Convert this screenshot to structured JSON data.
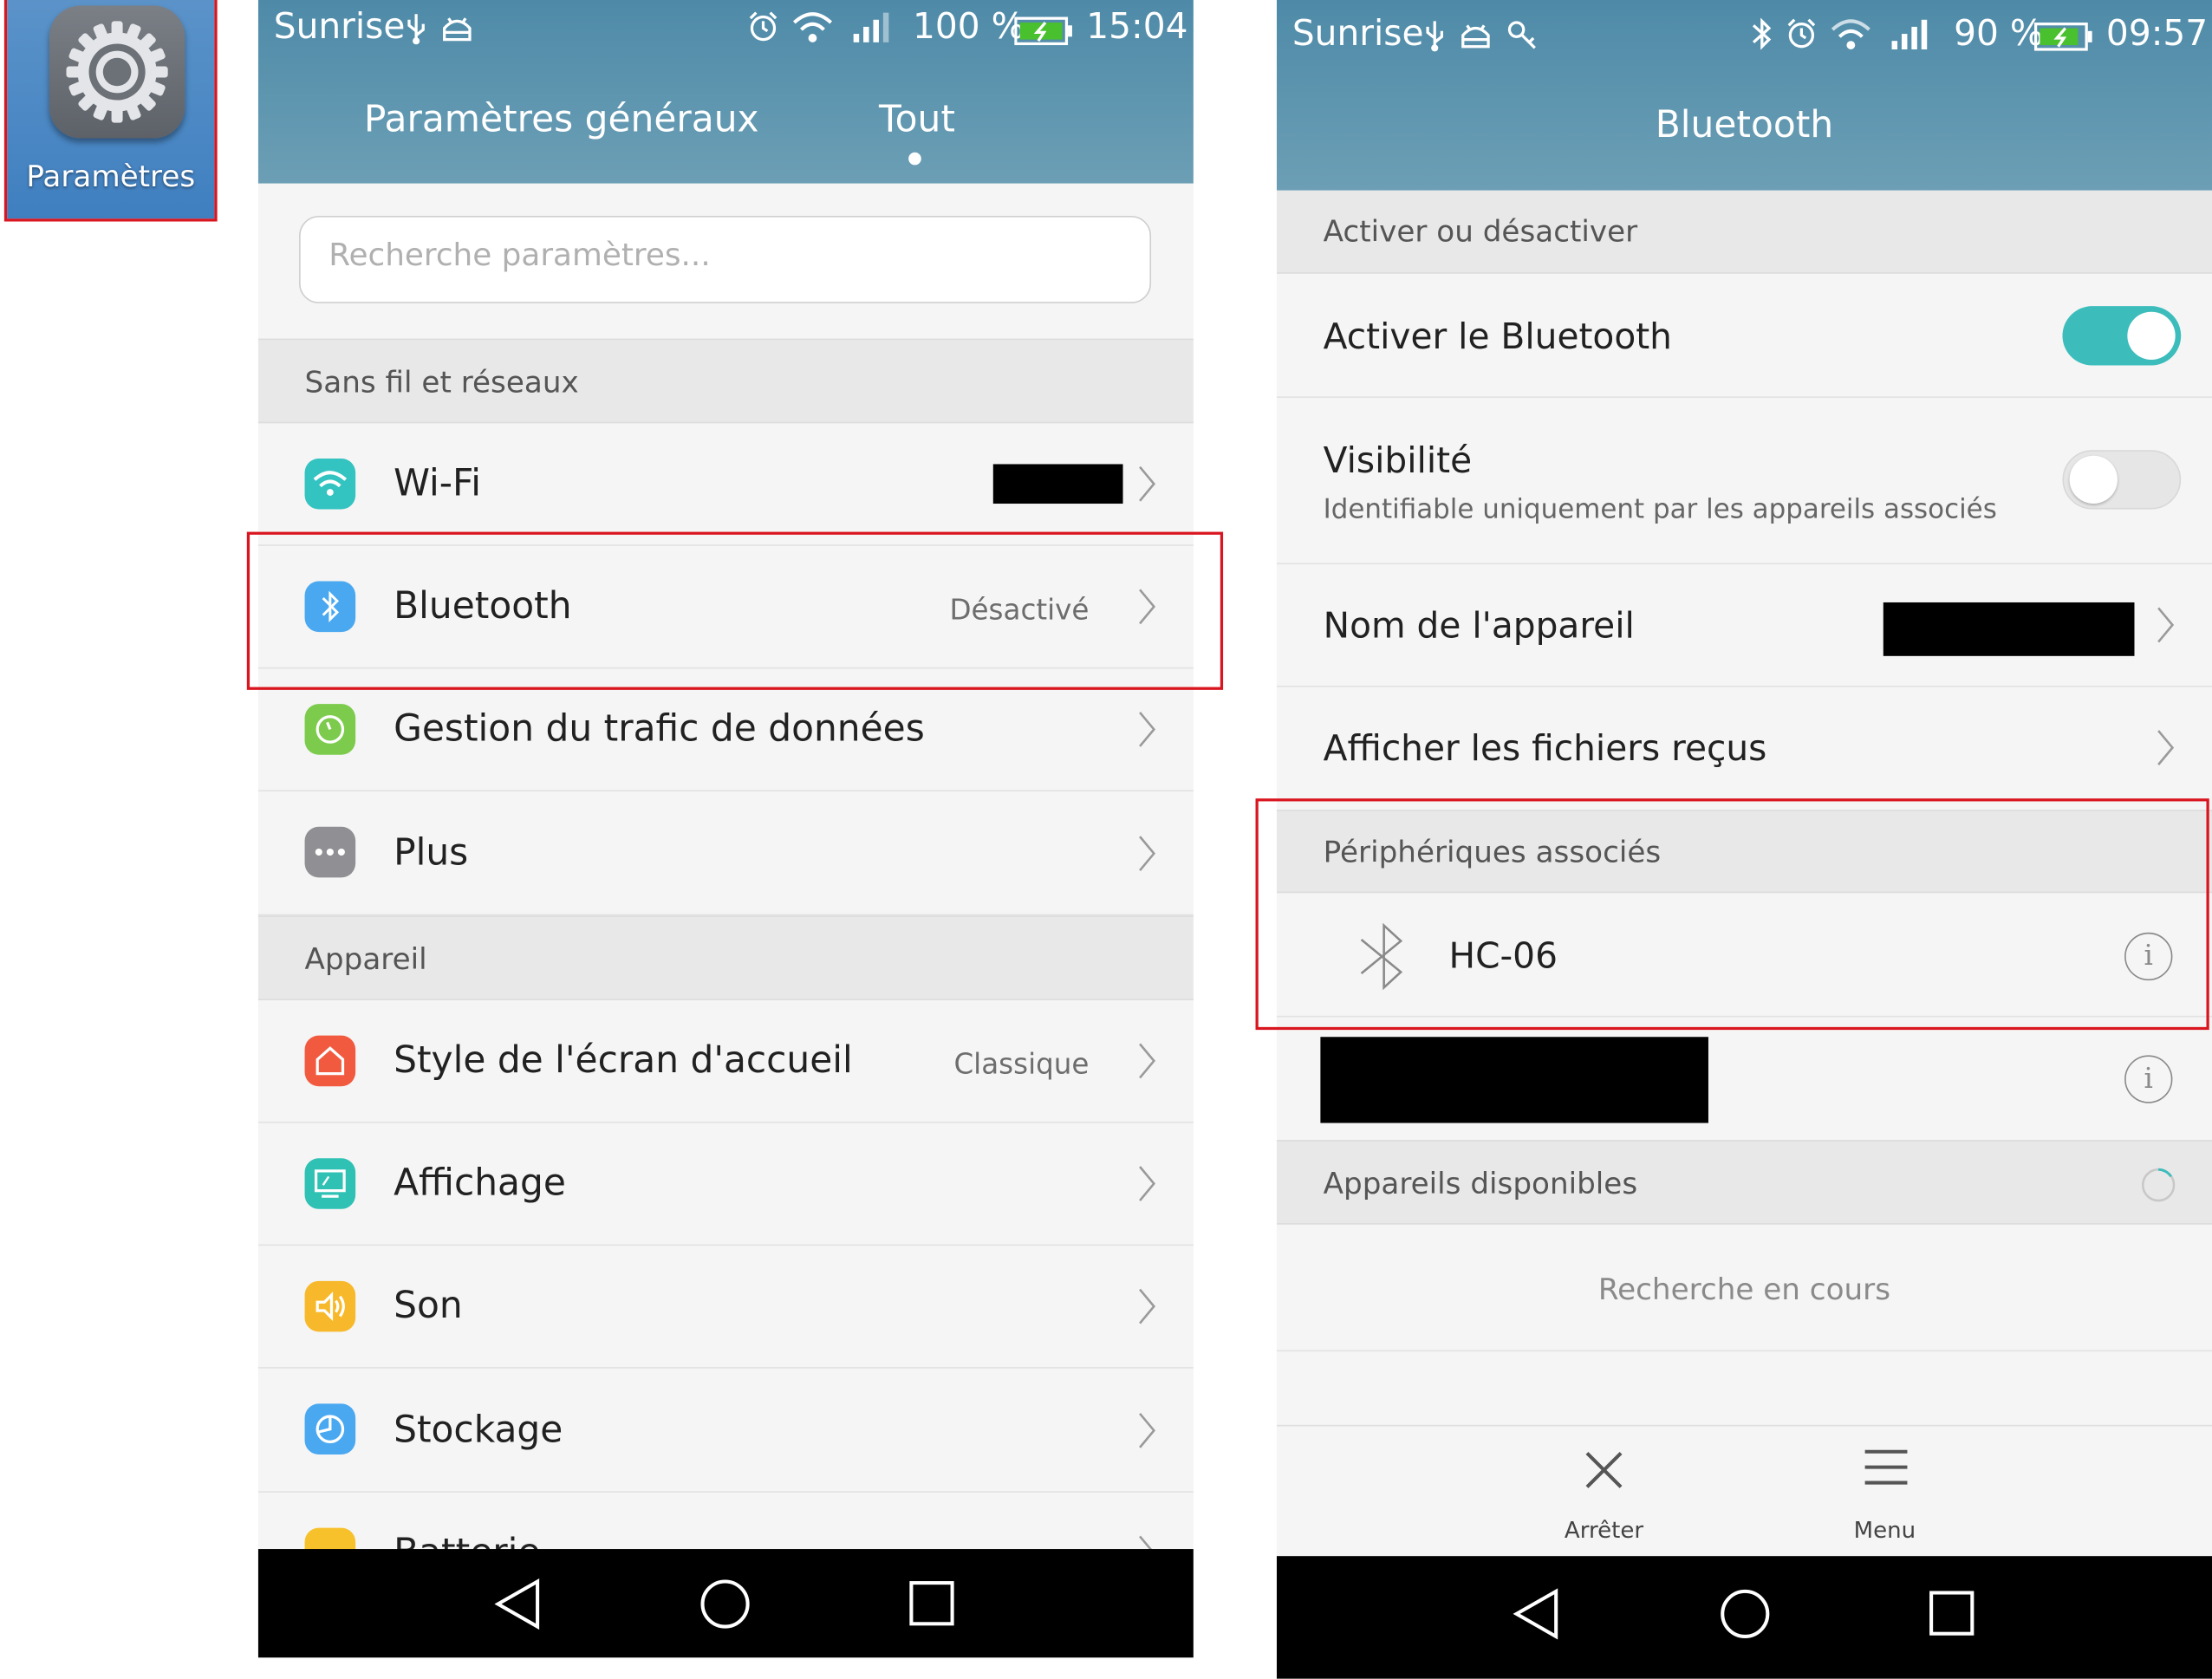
{
  "launcher": {
    "label": "Paramètres",
    "icon": "settings-gear-icon"
  },
  "left_screen": {
    "status": {
      "carrier": "Sunrise",
      "battery": "100 %",
      "time": "15:04"
    },
    "tabs": [
      {
        "label": "Paramètres généraux"
      },
      {
        "label": "Tout"
      }
    ],
    "search": {
      "placeholder": "Recherche paramètres..."
    },
    "sections": [
      {
        "title": "Sans fil et réseaux",
        "items": [
          {
            "label": "Wi-Fi",
            "value": "",
            "icon": "wifi-icon",
            "color": "#33c3c0"
          },
          {
            "label": "Bluetooth",
            "value": "Désactivé",
            "icon": "bluetooth-icon",
            "color": "#4aa8f0"
          },
          {
            "label": "Gestion du trafic de données",
            "value": "",
            "icon": "data-usage-icon",
            "color": "#7ccb4c"
          },
          {
            "label": "Plus",
            "value": "",
            "icon": "more-icon",
            "color": "#8f8f94"
          }
        ]
      },
      {
        "title": "Appareil",
        "items": [
          {
            "label": "Style de l'écran d'accueil",
            "value": "Classique",
            "icon": "home-icon",
            "color": "#f15a3f"
          },
          {
            "label": "Affichage",
            "value": "",
            "icon": "display-icon",
            "color": "#2ec1b4"
          },
          {
            "label": "Son",
            "value": "",
            "icon": "sound-icon",
            "color": "#f7b92b"
          },
          {
            "label": "Stockage",
            "value": "",
            "icon": "storage-icon",
            "color": "#4aa8f0"
          },
          {
            "label": "Batterie",
            "value": "",
            "icon": "battery-icon",
            "color": "#f7c12b"
          }
        ]
      }
    ]
  },
  "right_screen": {
    "status": {
      "carrier": "Sunrise",
      "battery": "90 %",
      "time": "09:57"
    },
    "title": "Bluetooth",
    "section_toggle": "Activer ou désactiver",
    "enable": {
      "label": "Activer le Bluetooth",
      "on": true
    },
    "visibility": {
      "label": "Visibilité",
      "sub": "Identifiable uniquement par les appareils associés",
      "on": false
    },
    "device_name": {
      "label": "Nom de l'appareil"
    },
    "received_files": {
      "label": "Afficher les fichiers reçus"
    },
    "paired_section": "Périphériques associés",
    "paired_devices": [
      {
        "name": "HC-06"
      }
    ],
    "available_section": "Appareils disponibles",
    "searching": "Recherche en cours",
    "bottom": {
      "stop": "Arrêter",
      "menu": "Menu"
    }
  },
  "colors": {
    "header": "#5a93ad",
    "accent_toggle": "#3cbdbc",
    "highlight": "#d9161f"
  }
}
